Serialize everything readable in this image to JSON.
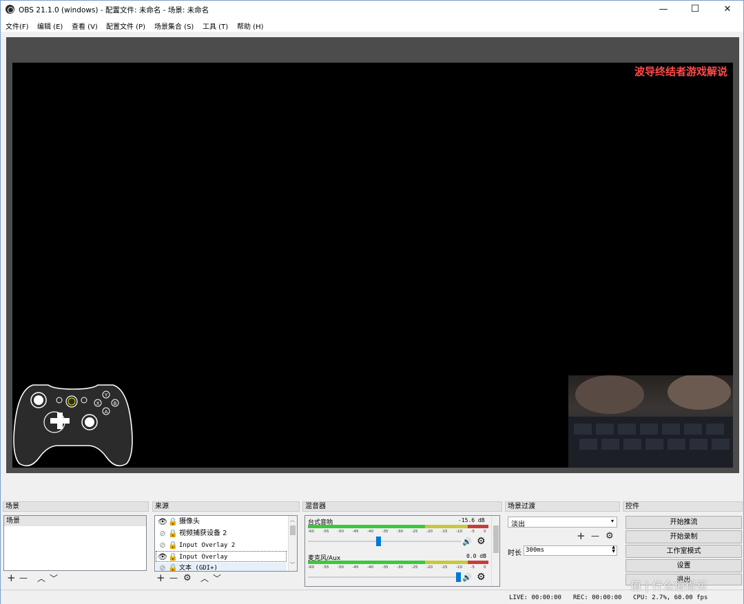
{
  "window": {
    "title": "OBS 21.1.0 (windows) - 配置文件: 未命名 - 场景: 未命名",
    "minimize": "—",
    "maximize": "☐",
    "close": "✕"
  },
  "menu": [
    "文件(F)",
    "编辑 (E)",
    "查看 (V)",
    "配置文件 (P)",
    "场景集合 (S)",
    "工具 (T)",
    "帮助 (H)"
  ],
  "preview": {
    "overlay_text": "波导终结者游戏解说",
    "controller_buttons": [
      "Y",
      "X",
      "B",
      "A"
    ]
  },
  "scenes": {
    "header": "场景",
    "items": [
      "场景"
    ],
    "toolbar": [
      "+",
      "—",
      "︿",
      "﹀"
    ]
  },
  "sources": {
    "header": "来源",
    "items": [
      {
        "label": "摄像头",
        "visible": true
      },
      {
        "label": "视频捕获设备 2",
        "visible": false
      },
      {
        "label": "Input Overlay 2",
        "visible": false
      },
      {
        "label": "Input Overlay",
        "visible": true
      },
      {
        "label": "文本 (GDI+)",
        "visible": false
      }
    ],
    "toolbar": [
      "+",
      "—",
      "⚙",
      "︿",
      "﹀"
    ]
  },
  "mixer": {
    "header": "混音器",
    "tick_labels": [
      "-60",
      "-55",
      "-50",
      "-45",
      "-40",
      "-35",
      "-30",
      "-25",
      "-20",
      "-15",
      "-10",
      "-5",
      "0"
    ],
    "channels": [
      {
        "name": "台式音响",
        "level": "-15.6 dB",
        "volume": 0.46
      },
      {
        "name": "麦克风/Aux",
        "level": "0.0 dB",
        "volume": 1.0
      }
    ],
    "mute_icon": "🔊",
    "settings_icon": "⚙"
  },
  "transitions": {
    "header": "场景过渡",
    "selected": "淡出",
    "duration_label": "时长",
    "duration_value": "300ms",
    "toolbar": [
      "+",
      "—",
      "⚙"
    ]
  },
  "controls": {
    "header": "控件",
    "buttons": [
      "开始推流",
      "开始录制",
      "工作室模式",
      "设置",
      "退出"
    ]
  },
  "status": {
    "live": "LIVE: 00:00:00",
    "rec": "REC: 00:00:00",
    "cpu": "CPU: 2.7%, 60.00 fps"
  },
  "watermark": "值 | 什么值得买",
  "colors": {
    "overlay_text": "#ff4b4b",
    "preview_bg": "#4c4c4c",
    "meter_green": "#3cc83c",
    "meter_yellow": "#c8c83c",
    "meter_red": "#c83c3c",
    "slider": "#0078d7"
  }
}
